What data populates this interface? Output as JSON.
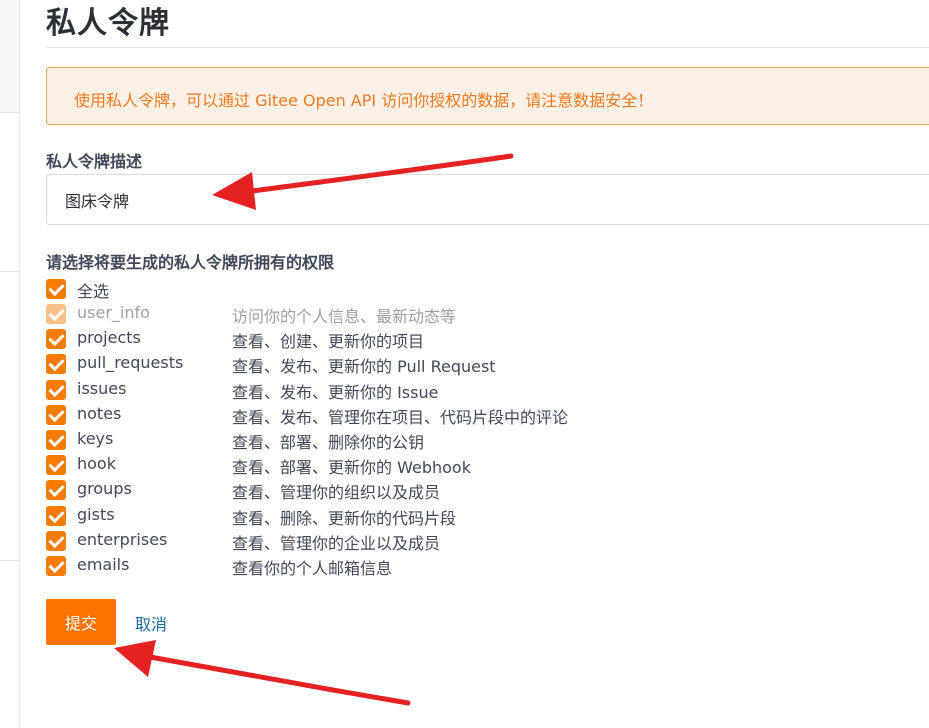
{
  "page": {
    "title": "私人令牌"
  },
  "notice": {
    "text": "使用私人令牌，可以通过 Gitee Open API 访问你授权的数据，请注意数据安全！"
  },
  "description": {
    "label": "私人令牌描述",
    "value": "图床令牌"
  },
  "permissions": {
    "label": "请选择将要生成的私人令牌所拥有的权限",
    "select_all": {
      "label": "全选",
      "checked": true
    },
    "items": [
      {
        "name": "user_info",
        "desc": "访问你的个人信息、最新动态等",
        "checked": true,
        "disabled": true
      },
      {
        "name": "projects",
        "desc": "查看、创建、更新你的项目",
        "checked": true
      },
      {
        "name": "pull_requests",
        "desc": "查看、发布、更新你的 Pull Request",
        "checked": true
      },
      {
        "name": "issues",
        "desc": "查看、发布、更新你的 Issue",
        "checked": true
      },
      {
        "name": "notes",
        "desc": "查看、发布、管理你在项目、代码片段中的评论",
        "checked": true
      },
      {
        "name": "keys",
        "desc": "查看、部署、删除你的公钥",
        "checked": true
      },
      {
        "name": "hook",
        "desc": "查看、部署、更新你的 Webhook",
        "checked": true
      },
      {
        "name": "groups",
        "desc": "查看、管理你的组织以及成员",
        "checked": true
      },
      {
        "name": "gists",
        "desc": "查看、删除、更新你的代码片段",
        "checked": true
      },
      {
        "name": "enterprises",
        "desc": "查看、管理你的企业以及成员",
        "checked": true
      },
      {
        "name": "emails",
        "desc": "查看你的个人邮箱信息",
        "checked": true
      }
    ]
  },
  "actions": {
    "submit_label": "提交",
    "cancel_label": "取消"
  },
  "colors": {
    "accent": "#fe7300",
    "notice_text": "#f07b1e",
    "notice_bg": "#fdf0e6",
    "annotation_arrow": "#e52222"
  }
}
